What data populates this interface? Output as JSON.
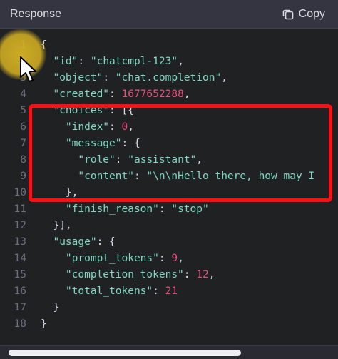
{
  "header": {
    "title": "Response",
    "copy_label": "Copy",
    "copy_icon": "copy-icon"
  },
  "code": {
    "lines": [
      {
        "num": "1",
        "tokens": [
          {
            "t": "{",
            "c": "p"
          }
        ]
      },
      {
        "num": "2",
        "tokens": [
          {
            "t": "  ",
            "c": "p"
          },
          {
            "t": "\"id\"",
            "c": "k"
          },
          {
            "t": ": ",
            "c": "p"
          },
          {
            "t": "\"chatcmpl-123\"",
            "c": "s"
          },
          {
            "t": ",",
            "c": "p"
          }
        ]
      },
      {
        "num": "3",
        "tokens": [
          {
            "t": "  ",
            "c": "p"
          },
          {
            "t": "\"object\"",
            "c": "k"
          },
          {
            "t": ": ",
            "c": "p"
          },
          {
            "t": "\"chat.completion\"",
            "c": "s"
          },
          {
            "t": ",",
            "c": "p"
          }
        ]
      },
      {
        "num": "4",
        "tokens": [
          {
            "t": "  ",
            "c": "p"
          },
          {
            "t": "\"created\"",
            "c": "k"
          },
          {
            "t": ": ",
            "c": "p"
          },
          {
            "t": "1677652288",
            "c": "n"
          },
          {
            "t": ",",
            "c": "p"
          }
        ]
      },
      {
        "num": "5",
        "tokens": [
          {
            "t": "  ",
            "c": "p"
          },
          {
            "t": "\"choices\"",
            "c": "k"
          },
          {
            "t": ": [{",
            "c": "p"
          }
        ]
      },
      {
        "num": "6",
        "tokens": [
          {
            "t": "    ",
            "c": "p"
          },
          {
            "t": "\"index\"",
            "c": "k"
          },
          {
            "t": ": ",
            "c": "p"
          },
          {
            "t": "0",
            "c": "n"
          },
          {
            "t": ",",
            "c": "p"
          }
        ]
      },
      {
        "num": "7",
        "tokens": [
          {
            "t": "    ",
            "c": "p"
          },
          {
            "t": "\"message\"",
            "c": "k"
          },
          {
            "t": ": {",
            "c": "p"
          }
        ]
      },
      {
        "num": "8",
        "tokens": [
          {
            "t": "      ",
            "c": "p"
          },
          {
            "t": "\"role\"",
            "c": "k"
          },
          {
            "t": ": ",
            "c": "p"
          },
          {
            "t": "\"assistant\"",
            "c": "s"
          },
          {
            "t": ",",
            "c": "p"
          }
        ]
      },
      {
        "num": "9",
        "tokens": [
          {
            "t": "      ",
            "c": "p"
          },
          {
            "t": "\"content\"",
            "c": "k"
          },
          {
            "t": ": ",
            "c": "p"
          },
          {
            "t": "\"\\n\\nHello there, how may I",
            "c": "s"
          }
        ]
      },
      {
        "num": "10",
        "tokens": [
          {
            "t": "    },",
            "c": "p"
          }
        ]
      },
      {
        "num": "11",
        "tokens": [
          {
            "t": "    ",
            "c": "p"
          },
          {
            "t": "\"finish_reason\"",
            "c": "k"
          },
          {
            "t": ": ",
            "c": "p"
          },
          {
            "t": "\"stop\"",
            "c": "s"
          }
        ]
      },
      {
        "num": "12",
        "tokens": [
          {
            "t": "  }],",
            "c": "p"
          }
        ]
      },
      {
        "num": "13",
        "tokens": [
          {
            "t": "  ",
            "c": "p"
          },
          {
            "t": "\"usage\"",
            "c": "k"
          },
          {
            "t": ": {",
            "c": "p"
          }
        ]
      },
      {
        "num": "14",
        "tokens": [
          {
            "t": "    ",
            "c": "p"
          },
          {
            "t": "\"prompt_tokens\"",
            "c": "k"
          },
          {
            "t": ": ",
            "c": "p"
          },
          {
            "t": "9",
            "c": "n"
          },
          {
            "t": ",",
            "c": "p"
          }
        ]
      },
      {
        "num": "15",
        "tokens": [
          {
            "t": "    ",
            "c": "p"
          },
          {
            "t": "\"completion_tokens\"",
            "c": "k"
          },
          {
            "t": ": ",
            "c": "p"
          },
          {
            "t": "12",
            "c": "n"
          },
          {
            "t": ",",
            "c": "p"
          }
        ]
      },
      {
        "num": "16",
        "tokens": [
          {
            "t": "    ",
            "c": "p"
          },
          {
            "t": "\"total_tokens\"",
            "c": "k"
          },
          {
            "t": ": ",
            "c": "p"
          },
          {
            "t": "21",
            "c": "n"
          }
        ]
      },
      {
        "num": "17",
        "tokens": [
          {
            "t": "  }",
            "c": "p"
          }
        ]
      },
      {
        "num": "18",
        "tokens": [
          {
            "t": "}",
            "c": "p"
          }
        ]
      }
    ]
  },
  "colors": {
    "key": "#7fd8c0",
    "number": "#e54f7a",
    "punct": "#d9d9e3",
    "highlight": "#ff0f14",
    "cursor_glow": "#d6b223"
  },
  "scroll": {
    "horizontal_position": 0,
    "visible_fraction": 0.7
  }
}
